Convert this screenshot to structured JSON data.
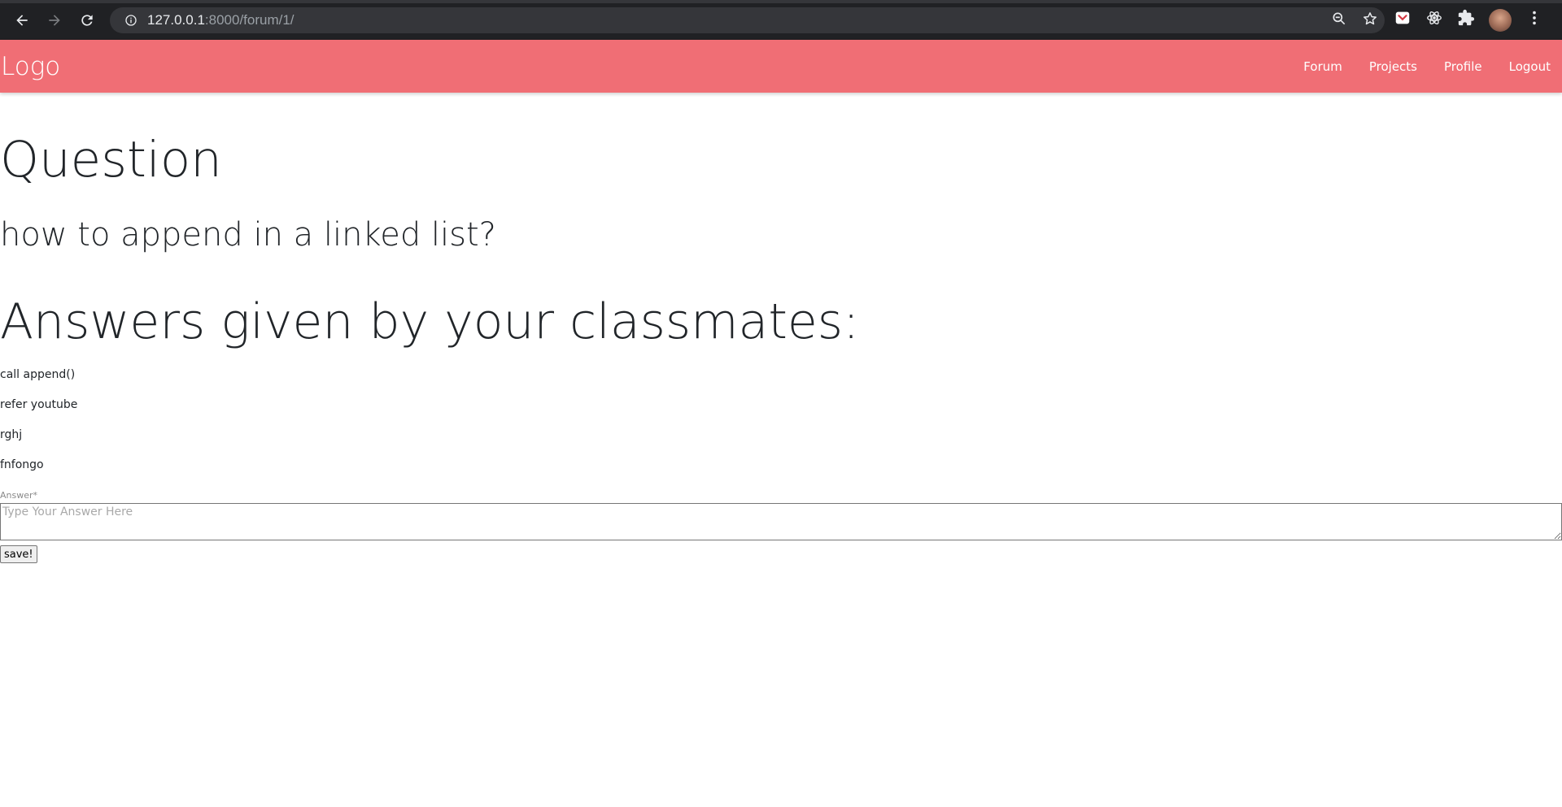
{
  "browser": {
    "url_host": "127.0.0.1",
    "url_rest": ":8000/forum/1/",
    "icons": [
      "back-icon",
      "forward-icon",
      "reload-icon",
      "site-info-icon",
      "zoom-icon",
      "bookmark-star-icon",
      "pocket-extension-icon",
      "react-devtools-icon",
      "extensions-puzzle-icon",
      "profile-avatar",
      "menu-kebab-icon"
    ]
  },
  "navbar": {
    "logo": "Logo",
    "links": [
      {
        "label": "Forum"
      },
      {
        "label": "Projects"
      },
      {
        "label": "Profile"
      },
      {
        "label": "Logout"
      }
    ],
    "background_color": "#f06e75"
  },
  "question": {
    "heading": "Question",
    "text": "how to append in a linked list?"
  },
  "answers": {
    "heading": "Answers given by your classmates:",
    "items": [
      "call append()",
      "refer youtube",
      "rghj",
      "fnfongo"
    ]
  },
  "form": {
    "label": "Answer*",
    "placeholder": "Type Your Answer Here",
    "value": "",
    "submit_label": "save!"
  }
}
